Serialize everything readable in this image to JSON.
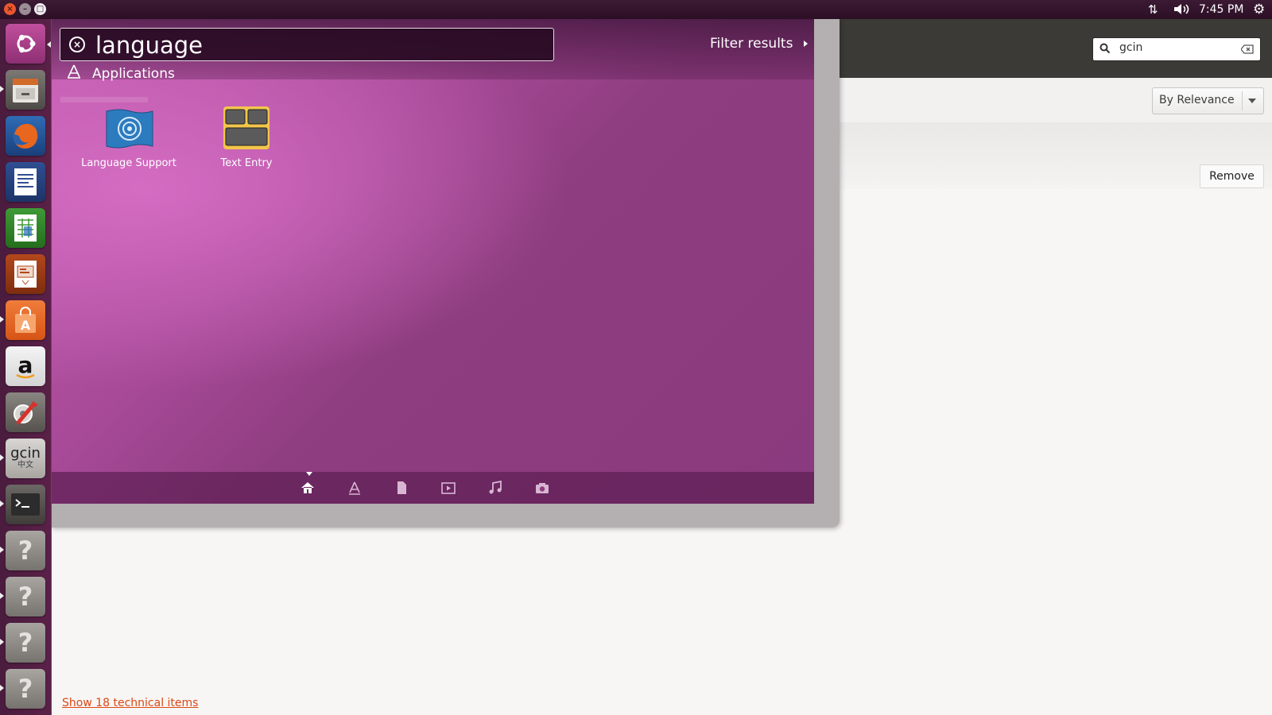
{
  "top_panel": {
    "window_controls": [
      "close",
      "minimize",
      "maximize"
    ],
    "icons": [
      "network-icon",
      "volume-icon",
      "gear-icon"
    ],
    "clock": "7:45 PM"
  },
  "launcher": {
    "items": [
      {
        "name": "dash-home",
        "icon": "ubuntu-logo-icon"
      },
      {
        "name": "files",
        "icon": "file-cabinet-icon"
      },
      {
        "name": "firefox",
        "icon": "firefox-icon"
      },
      {
        "name": "writer",
        "icon": "document-icon"
      },
      {
        "name": "calc",
        "icon": "spreadsheet-icon"
      },
      {
        "name": "impress",
        "icon": "presentation-icon"
      },
      {
        "name": "software-center",
        "icon": "shopping-bag-icon"
      },
      {
        "name": "amazon",
        "icon": "amazon-icon"
      },
      {
        "name": "system-settings",
        "icon": "settings-tools-icon"
      },
      {
        "name": "gcin",
        "icon": "gcin-icon",
        "label": "gcin",
        "sublabel": "中文"
      },
      {
        "name": "terminal",
        "icon": "terminal-icon"
      },
      {
        "name": "unknown-1",
        "icon": "question-icon"
      },
      {
        "name": "unknown-2",
        "icon": "question-icon"
      },
      {
        "name": "unknown-3",
        "icon": "question-icon"
      },
      {
        "name": "unknown-4",
        "icon": "question-icon"
      }
    ]
  },
  "dash": {
    "search": {
      "value": "language"
    },
    "filter_results": "Filter results",
    "category": "Applications",
    "results": [
      {
        "label": "Language Support",
        "icon": "language-support-icon"
      },
      {
        "label": "Text Entry",
        "icon": "text-entry-icon"
      }
    ],
    "lenses": [
      "home-icon",
      "applications-icon",
      "files-icon",
      "video-icon",
      "music-icon",
      "photos-icon"
    ]
  },
  "software_center": {
    "search": {
      "value": "gcin"
    },
    "sort": {
      "selected": "By Relevance"
    },
    "remove_label": "Remove",
    "technical_items_link": "Show 18 technical items"
  },
  "colors": {
    "dash_accent": "#a84a98",
    "panel_bg": "#2b0f25",
    "link_orange": "#dd4814"
  }
}
